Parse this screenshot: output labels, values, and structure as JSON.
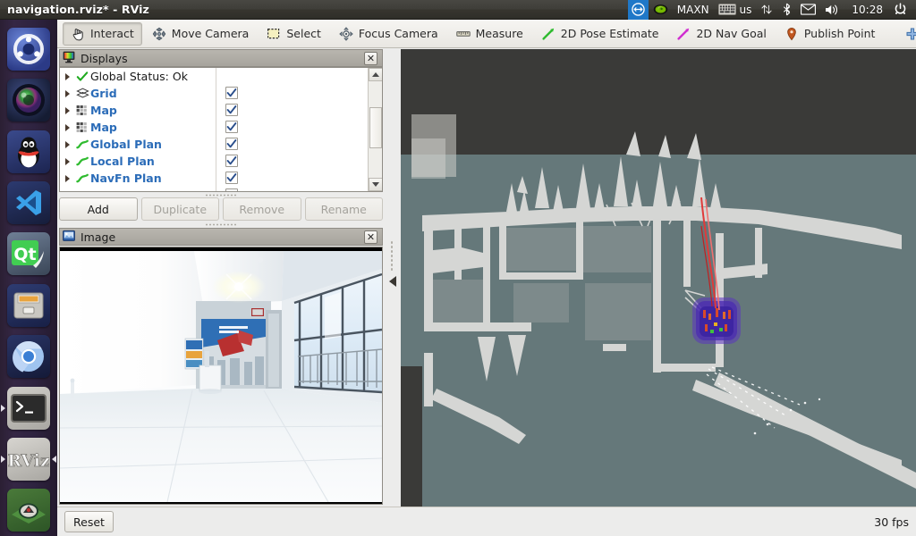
{
  "window": {
    "title": "navigation.rviz* - RViz"
  },
  "tray": {
    "items": [
      {
        "name": "teamviewer-icon",
        "label": ""
      },
      {
        "name": "nvidia-icon",
        "label": ""
      },
      {
        "name": "power-mode-label",
        "label": "MAXN"
      },
      {
        "name": "keyboard-layout-icon",
        "label": ""
      },
      {
        "name": "keyboard-layout-label",
        "label": "us"
      },
      {
        "name": "network-icon",
        "label": ""
      },
      {
        "name": "bluetooth-icon",
        "label": ""
      },
      {
        "name": "mail-icon",
        "label": ""
      },
      {
        "name": "volume-icon",
        "label": ""
      },
      {
        "name": "clock",
        "label": "10:28"
      },
      {
        "name": "session-menu-icon",
        "label": ""
      }
    ],
    "clock": "10:28",
    "power_mode": "MAXN",
    "keyboard_layout": "us"
  },
  "launcher": {
    "items": [
      {
        "name": "ubuntu-dash",
        "label": "Ubuntu",
        "running": false
      },
      {
        "name": "camera-app",
        "label": "Camera",
        "running": false
      },
      {
        "name": "qq-messenger",
        "label": "QQ",
        "running": false
      },
      {
        "name": "vscode",
        "label": "Visual Studio Code",
        "running": false
      },
      {
        "name": "qt-creator",
        "label": "Qt Creator",
        "running": false
      },
      {
        "name": "file-manager",
        "label": "Files",
        "running": false
      },
      {
        "name": "chromium-browser",
        "label": "Chromium",
        "running": false
      },
      {
        "name": "terminal",
        "label": "Terminal",
        "running": true
      },
      {
        "name": "rviz",
        "label": "RViz",
        "running": true
      },
      {
        "name": "android-studio",
        "label": "Android",
        "running": false
      }
    ]
  },
  "toolbar": {
    "tools": [
      {
        "name": "interact",
        "label": "Interact",
        "icon": "hand-icon",
        "active": true
      },
      {
        "name": "move-camera",
        "label": "Move Camera",
        "icon": "move-camera-icon",
        "active": false
      },
      {
        "name": "select",
        "label": "Select",
        "icon": "select-box-icon",
        "active": false
      },
      {
        "name": "focus-camera",
        "label": "Focus Camera",
        "icon": "focus-camera-icon",
        "active": false
      },
      {
        "name": "measure",
        "label": "Measure",
        "icon": "ruler-icon",
        "active": false
      },
      {
        "name": "2d-pose-estimate",
        "label": "2D Pose Estimate",
        "icon": "green-arrow-icon",
        "active": false
      },
      {
        "name": "2d-nav-goal",
        "label": "2D Nav Goal",
        "icon": "magenta-arrow-icon",
        "active": false
      },
      {
        "name": "publish-point",
        "label": "Publish Point",
        "icon": "map-pin-icon",
        "active": false
      }
    ],
    "add_tool_label": "+",
    "remove_tool_label": "−",
    "overflow_label": "»"
  },
  "displays_panel": {
    "title": "Displays",
    "close_label": "✕",
    "tree": [
      {
        "label": "Global Status: Ok",
        "icon": "green-check-icon",
        "has_checkbox": false,
        "checked": false,
        "style": "plain"
      },
      {
        "label": "Grid",
        "icon": "grid-icon",
        "has_checkbox": true,
        "checked": true,
        "style": "link"
      },
      {
        "label": "Map",
        "icon": "map-icon",
        "has_checkbox": true,
        "checked": true,
        "style": "link"
      },
      {
        "label": "Map",
        "icon": "map-icon",
        "has_checkbox": true,
        "checked": true,
        "style": "link"
      },
      {
        "label": "Global Plan",
        "icon": "path-icon",
        "has_checkbox": true,
        "checked": true,
        "style": "link"
      },
      {
        "label": "Local Plan",
        "icon": "path-icon",
        "has_checkbox": true,
        "checked": true,
        "style": "link"
      },
      {
        "label": "NavFn Plan",
        "icon": "path-icon",
        "has_checkbox": true,
        "checked": true,
        "style": "link"
      }
    ],
    "buttons": [
      {
        "name": "add-display-button",
        "label": "Add",
        "enabled": true
      },
      {
        "name": "duplicate-display-button",
        "label": "Duplicate",
        "enabled": false
      },
      {
        "name": "remove-display-button",
        "label": "Remove",
        "enabled": false
      },
      {
        "name": "rename-display-button",
        "label": "Rename",
        "enabled": false
      }
    ]
  },
  "image_panel": {
    "title": "Image",
    "close_label": "✕"
  },
  "statusbar": {
    "reset_label": "Reset",
    "fps": "30 fps"
  },
  "colors": {
    "link_blue": "#2b6cb8",
    "panel_gray": "#ececeb",
    "title_bar": "#3f3e39",
    "map_free": "#65787a",
    "map_occupied": "#d5d6d4",
    "map_unknown": "#3a3a38",
    "costmap_purple": "#6a3ec8",
    "path_red": "#e03a3a",
    "nav_goal_magenta": "#d633d6",
    "pose_estimate_green": "#35c135"
  }
}
